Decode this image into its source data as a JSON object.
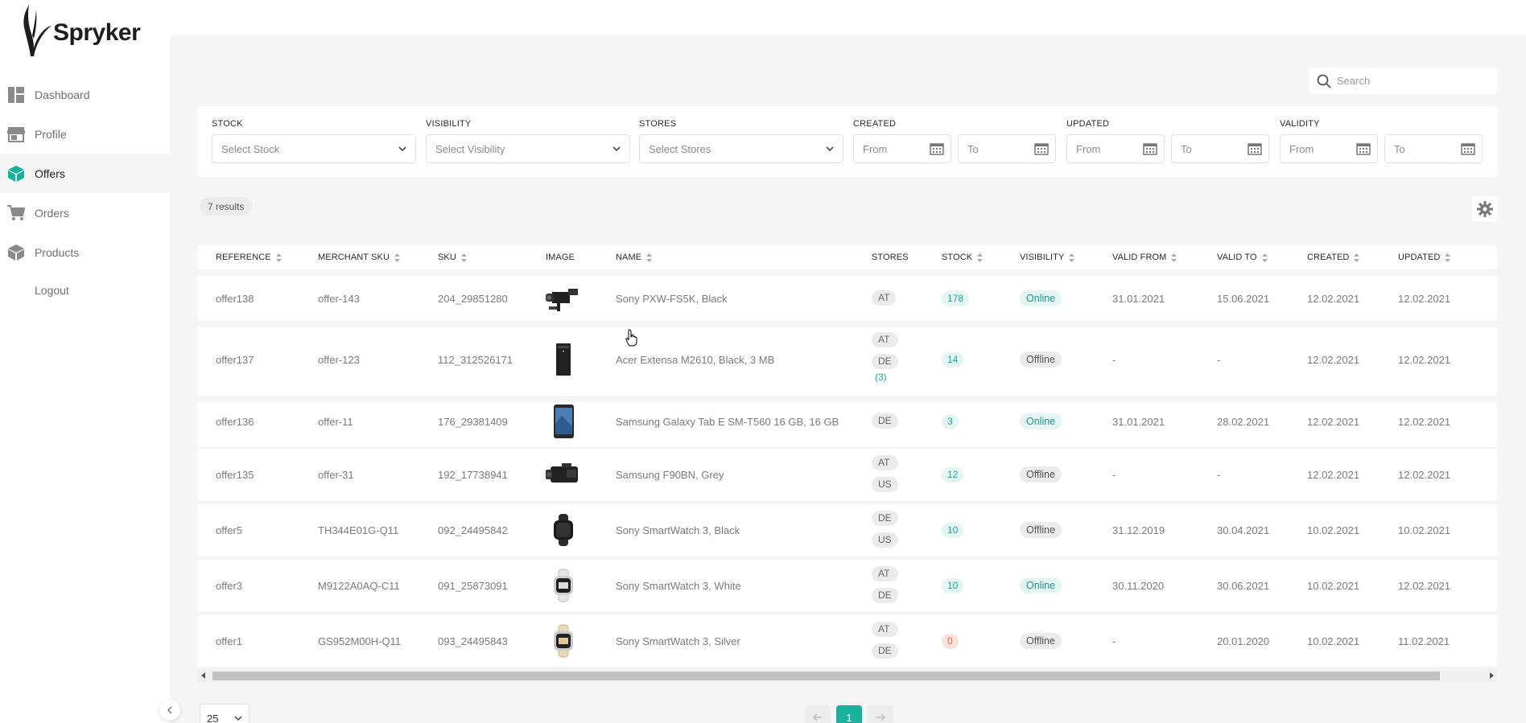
{
  "brand": {
    "name": "Spryker"
  },
  "sidebar": {
    "items": [
      {
        "label": "Dashboard",
        "icon": "dashboard-icon"
      },
      {
        "label": "Profile",
        "icon": "store-icon"
      },
      {
        "label": "Offers",
        "icon": "offers-cube-icon",
        "active": true
      },
      {
        "label": "Orders",
        "icon": "cart-icon"
      },
      {
        "label": "Products",
        "icon": "products-box-icon"
      }
    ],
    "logout_label": "Logout"
  },
  "search": {
    "placeholder": "Search"
  },
  "filters": {
    "stock": {
      "label": "STOCK",
      "placeholder": "Select Stock"
    },
    "visibility": {
      "label": "VISIBILITY",
      "placeholder": "Select Visibility"
    },
    "stores": {
      "label": "STORES",
      "placeholder": "Select Stores"
    },
    "created": {
      "label": "CREATED",
      "from": "From",
      "to": "To"
    },
    "updated": {
      "label": "UPDATED",
      "from": "From",
      "to": "To"
    },
    "validity": {
      "label": "VALIDITY",
      "from": "From",
      "to": "To"
    }
  },
  "results": {
    "text": "7 results"
  },
  "table": {
    "columns": [
      "REFERENCE",
      "MERCHANT SKU",
      "SKU",
      "IMAGE",
      "NAME",
      "STORES",
      "STOCK",
      "VISIBILITY",
      "VALID FROM",
      "VALID TO",
      "CREATED",
      "UPDATED"
    ],
    "rows": [
      {
        "reference": "offer138",
        "merchant_sku": "offer-143",
        "sku": "204_29851280",
        "image": "camcorder",
        "name": "Sony PXW-FS5K, Black",
        "stores": [
          "AT"
        ],
        "stores_more": "",
        "stock": "178",
        "visibility": "Online",
        "valid_from": "31.01.2021",
        "valid_to": "15.06.2021",
        "created": "12.02.2021",
        "updated": "12.02.2021"
      },
      {
        "reference": "offer137",
        "merchant_sku": "offer-123",
        "sku": "112_312526171",
        "image": "pc-tower",
        "name": "Acer Extensa M2610, Black, 3 MB",
        "stores": [
          "AT",
          "DE"
        ],
        "stores_more": "(3)",
        "stock": "14",
        "visibility": "Offline",
        "valid_from": "-",
        "valid_to": "-",
        "created": "12.02.2021",
        "updated": "12.02.2021"
      },
      {
        "reference": "offer136",
        "merchant_sku": "offer-11",
        "sku": "176_29381409",
        "image": "tablet",
        "name": "Samsung Galaxy Tab E SM-T560 16 GB, 16 GB",
        "stores": [
          "DE"
        ],
        "stores_more": "",
        "stock": "3",
        "visibility": "Online",
        "valid_from": "31.01.2021",
        "valid_to": "28.02.2021",
        "created": "12.02.2021",
        "updated": "12.02.2021"
      },
      {
        "reference": "offer135",
        "merchant_sku": "offer-31",
        "sku": "192_17738941",
        "image": "handycam",
        "name": "Samsung F90BN, Grey",
        "stores": [
          "AT",
          "US"
        ],
        "stores_more": "",
        "stock": "12",
        "visibility": "Offline",
        "valid_from": "-",
        "valid_to": "-",
        "created": "12.02.2021",
        "updated": "12.02.2021"
      },
      {
        "reference": "offer5",
        "merchant_sku": "TH344E01G-Q11",
        "sku": "092_24495842",
        "image": "watch-black",
        "name": "Sony SmartWatch 3, Black",
        "stores": [
          "DE",
          "US"
        ],
        "stores_more": "",
        "stock": "10",
        "visibility": "Offline",
        "valid_from": "31.12.2019",
        "valid_to": "30.04.2021",
        "created": "10.02.2021",
        "updated": "10.02.2021"
      },
      {
        "reference": "offer3",
        "merchant_sku": "M9122A0AQ-C11",
        "sku": "091_25873091",
        "image": "watch-white",
        "name": "Sony SmartWatch 3, White",
        "stores": [
          "AT",
          "DE"
        ],
        "stores_more": "",
        "stock": "10",
        "visibility": "Online",
        "valid_from": "30.11.2020",
        "valid_to": "30.06.2021",
        "created": "10.02.2021",
        "updated": "12.02.2021"
      },
      {
        "reference": "offer1",
        "merchant_sku": "GS952M00H-Q11",
        "sku": "093_24495843",
        "image": "watch-silver",
        "name": "Sony SmartWatch 3, Silver",
        "stores": [
          "AT",
          "DE"
        ],
        "stores_more": "",
        "stock": "0",
        "visibility": "Offline",
        "valid_from": "-",
        "valid_to": "20.01.2020",
        "created": "10.02.2021",
        "updated": "11.02.2021"
      }
    ]
  },
  "pagination": {
    "page_size": "25",
    "current_page": "1"
  },
  "colors": {
    "accent": "#17b19c",
    "online_bg": "#e5f5f3",
    "zero_stock_bg": "#fbe3dd"
  }
}
